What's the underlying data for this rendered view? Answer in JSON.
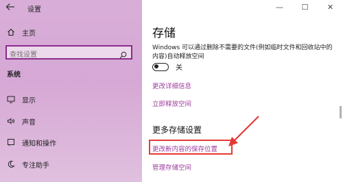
{
  "window": {
    "title": "设置",
    "controls": {
      "minimize": "—",
      "maximize": "☐",
      "close": "✕"
    }
  },
  "sidebar": {
    "home_label": "主页",
    "search_placeholder": "查找设置",
    "section_title": "系统",
    "items": [
      {
        "label": "显示",
        "icon": "monitor-icon"
      },
      {
        "label": "声音",
        "icon": "speaker-icon"
      },
      {
        "label": "通知和操作",
        "icon": "notification-icon"
      },
      {
        "label": "专注助手",
        "icon": "moon-icon"
      }
    ]
  },
  "main": {
    "heading": "存储",
    "description": "Windows 可以通过删除不需要的文件(例如临时文件和回收站中的内容)自动释放空间",
    "toggle": {
      "state_label": "关",
      "on": false
    },
    "links": {
      "change_details": "更改详细信息",
      "free_space_now": "立即释放空间"
    },
    "more_settings_heading": "更多存储设置",
    "more_links": {
      "change_save_location": "更改新内容的保存位置",
      "manage_storage_spaces": "管理存储空间"
    }
  },
  "colors": {
    "accent": "#9b3a9b",
    "highlight": "#e53935",
    "sidebar_bg": "#d8aed8"
  }
}
